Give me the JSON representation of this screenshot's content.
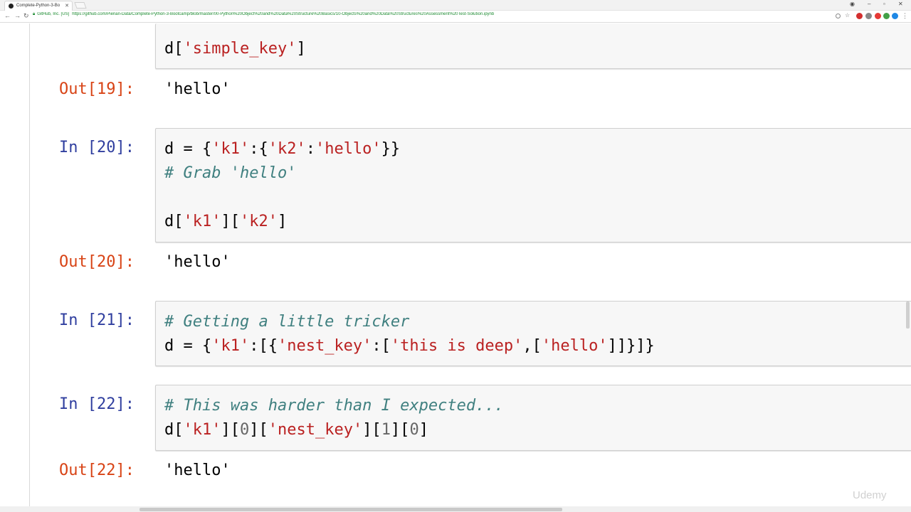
{
  "browser": {
    "tab_title": "Complete-Python-3-Bo",
    "org": "GitHub, Inc. [US]",
    "url": "https://github.com/Pierian-Data/Complete-Python-3-Bootcamp/blob/master/00-Python%20Object%20and%20Data%20Structure%20Basics/10-Objects%20and%20Data%20Structures%20Assessment%20Test-Solution.ipynb"
  },
  "notebook": {
    "cell19": {
      "code_line": "d['simple_key']",
      "out_prompt": "Out[19]:",
      "output": "'hello'"
    },
    "cell20": {
      "in_prompt": "In [20]:",
      "out_prompt": "Out[20]:",
      "output": "'hello'"
    },
    "cell21": {
      "in_prompt": "In [21]:"
    },
    "cell22": {
      "in_prompt": "In [22]:",
      "out_prompt": "Out[22]:",
      "output": "'hello'"
    }
  },
  "watermark": "Udemy"
}
